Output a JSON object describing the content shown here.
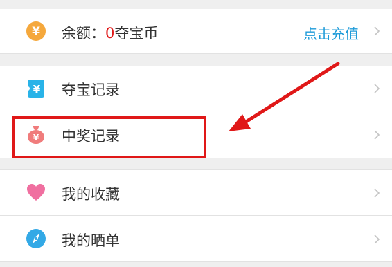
{
  "balance_row": {
    "icon": "yuan-coin-icon",
    "label_prefix": "余额：",
    "amount": "0",
    "unit": "夺宝币",
    "action": "点击充值",
    "amount_color": "#e01818",
    "action_color": "#1e9bd9"
  },
  "menu": [
    {
      "label": "夺宝记录",
      "icon": "yuan-ticket-icon"
    },
    {
      "label": "中奖记录",
      "icon": "money-bag-icon"
    },
    {
      "label": "我的收藏",
      "icon": "heart-icon"
    },
    {
      "label": "我的晒单",
      "icon": "compass-icon"
    }
  ],
  "colors": {
    "highlight": "#e01818",
    "coin": "#f5a83c",
    "ticket": "#29b3e8",
    "bag": "#f07c7c",
    "heart": "#f06fa0",
    "compass": "#33a9e6"
  }
}
